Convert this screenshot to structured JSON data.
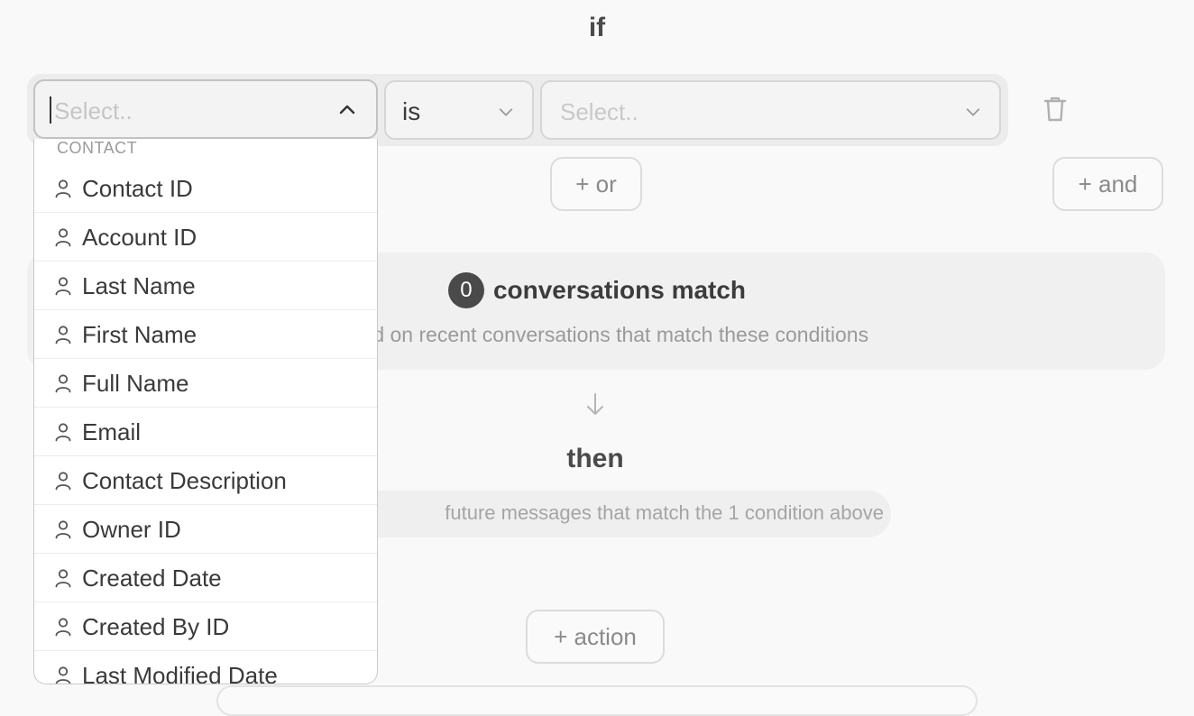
{
  "rule": {
    "if_label": "if",
    "condition": {
      "field_placeholder": "Select..",
      "operator_value": "is",
      "value_placeholder": "Select.."
    },
    "or_button": "+ or",
    "and_button": "+ and"
  },
  "match": {
    "count": "0",
    "title": "conversations match",
    "subtitle": "Based on recent conversations that match these conditions"
  },
  "then": {
    "label": "then",
    "subtitle": "future messages that match the 1 condition above"
  },
  "action_button": "+ action",
  "dropdown": {
    "group_label": "CONTACT",
    "options": [
      "Contact ID",
      "Account ID",
      "Last Name",
      "First Name",
      "Full Name",
      "Email",
      "Contact Description",
      "Owner ID",
      "Created Date",
      "Created By ID",
      "Last Modified Date"
    ]
  },
  "icons": {
    "option_icon": "person-icon",
    "delete_icon": "trash-icon",
    "down_arrow": "arrow-down-icon"
  }
}
